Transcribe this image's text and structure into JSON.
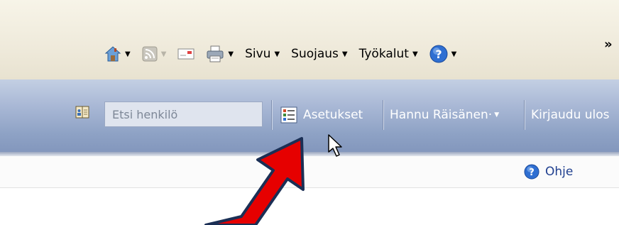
{
  "browser_toolbar": {
    "icons": [
      "home-icon",
      "feeds-icon",
      "read-mail-icon",
      "print-icon",
      "help-icon"
    ],
    "page_label": "Sivu",
    "safety_label": "Suojaus",
    "tools_label": "Työkalut",
    "overflow_label": "»"
  },
  "site_bar": {
    "search_placeholder": "Etsi henkilö",
    "settings_label": "Asetukset",
    "user_label": "Hannu Räisänen·",
    "signout_label": "Kirjaudu ulos"
  },
  "help_row": {
    "help_label": "Ohje"
  },
  "colors": {
    "accent_blue": "#8ea2c5",
    "annotation_arrow": "#e00000",
    "help_icon": "#2f6fd2"
  }
}
